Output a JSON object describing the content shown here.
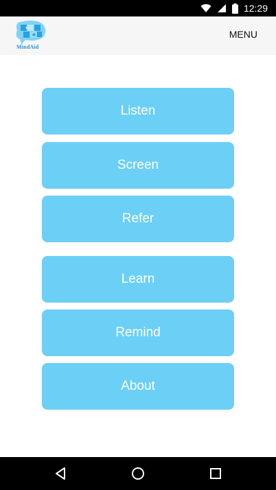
{
  "status_bar": {
    "time": "12:29",
    "icons": [
      "wifi-icon",
      "signal-icon",
      "battery-icon"
    ]
  },
  "app_bar": {
    "logo_text": "MindAid",
    "menu_label": "MENU"
  },
  "buttons": [
    {
      "label": "Listen"
    },
    {
      "label": "Screen"
    },
    {
      "label": "Refer"
    },
    {
      "label": "Learn"
    },
    {
      "label": "Remind"
    },
    {
      "label": "About"
    }
  ],
  "nav_bar": {
    "icons": [
      "back-icon",
      "home-icon",
      "recents-icon"
    ]
  },
  "colors": {
    "button": "#6ccff6",
    "app_bar": "#f6f6f6",
    "logo": "#2b8fd6"
  }
}
